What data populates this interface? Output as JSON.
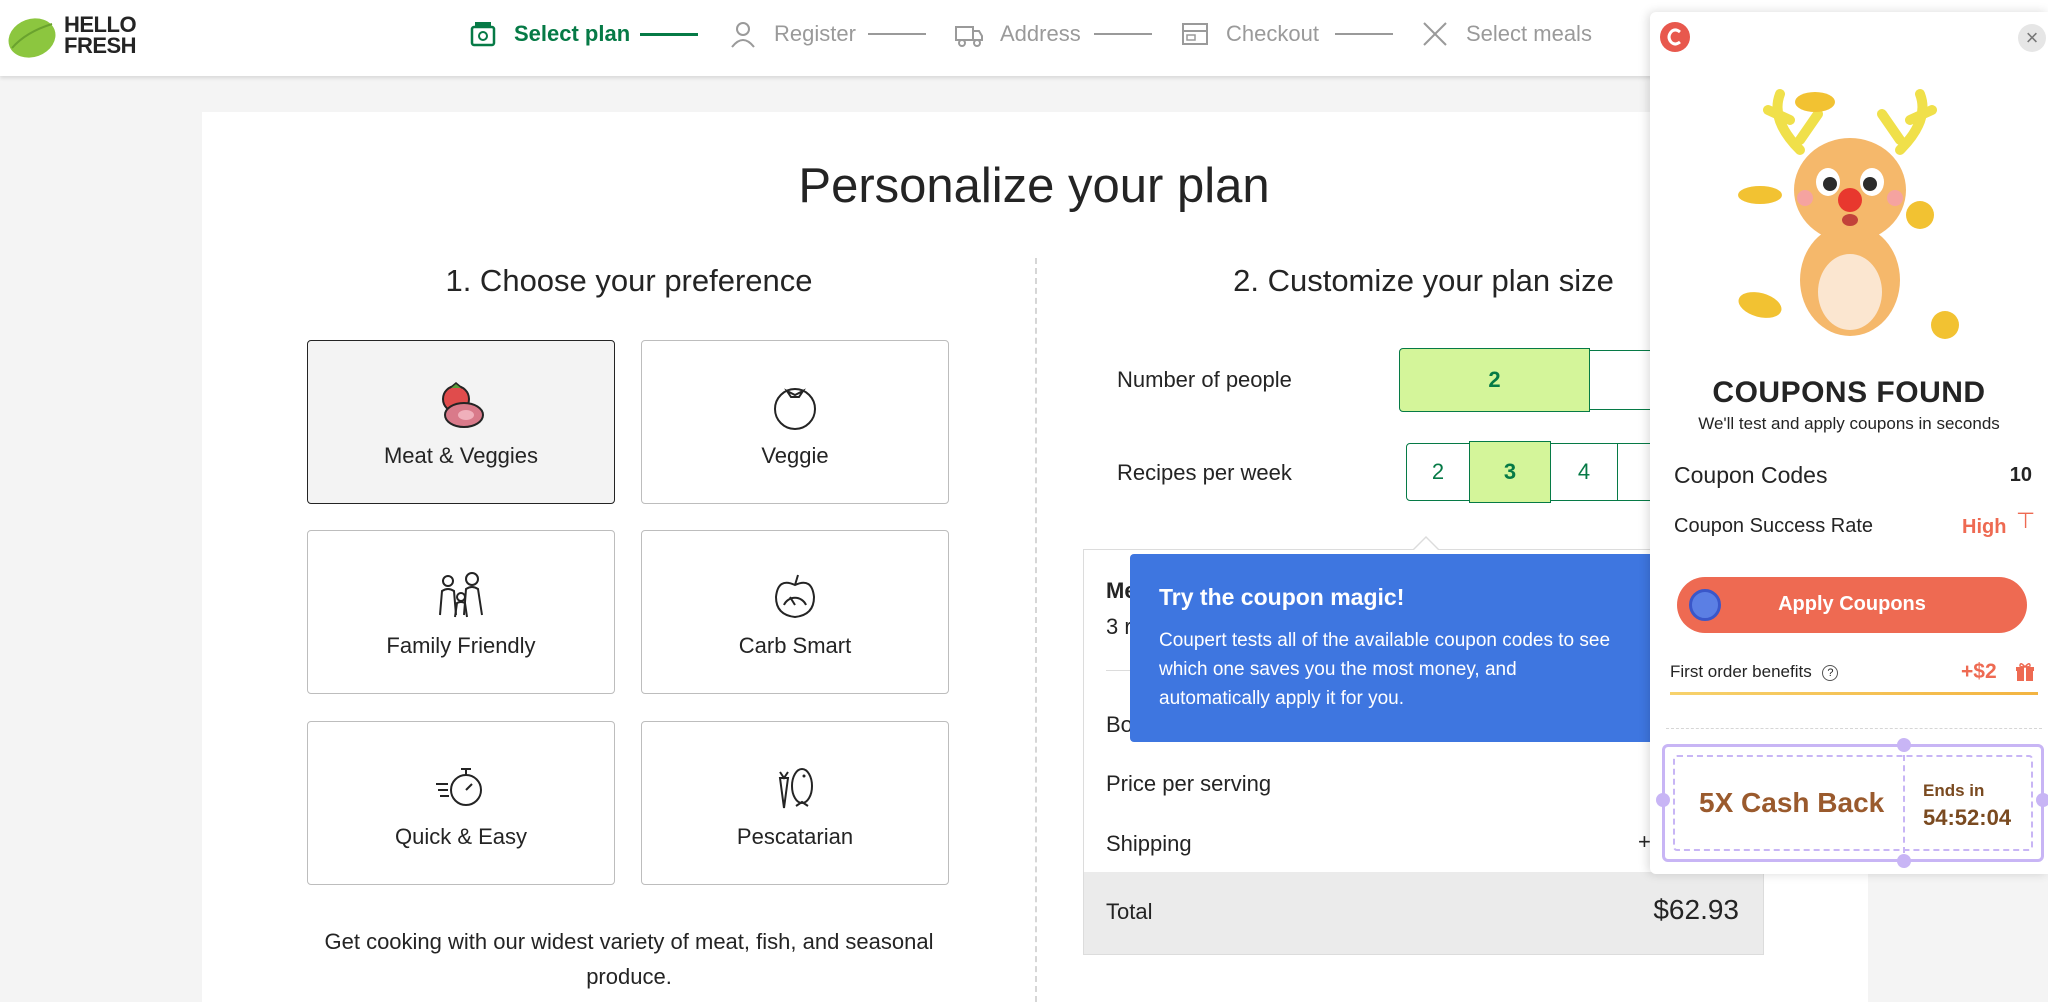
{
  "header": {
    "logo_line1": "HELLO",
    "logo_line2": "FRESH",
    "steps": [
      {
        "label": "Select plan",
        "icon": "plan-icon",
        "active": true
      },
      {
        "label": "Register",
        "icon": "user-icon",
        "active": false
      },
      {
        "label": "Address",
        "icon": "truck-icon",
        "active": false
      },
      {
        "label": "Checkout",
        "icon": "card-icon",
        "active": false
      },
      {
        "label": "Select meals",
        "icon": "fork-knife-icon",
        "active": false
      }
    ]
  },
  "page": {
    "title": "Personalize your plan",
    "section1_title": "1. Choose your preference",
    "section2_title": "2. Customize your plan size",
    "preferences": [
      {
        "label": "Meat & Veggies",
        "icon": "meat-veggies-icon",
        "selected": true
      },
      {
        "label": "Veggie",
        "icon": "tomato-icon",
        "selected": false
      },
      {
        "label": "Family Friendly",
        "icon": "family-icon",
        "selected": false
      },
      {
        "label": "Carb Smart",
        "icon": "apple-gauge-icon",
        "selected": false
      },
      {
        "label": "Quick & Easy",
        "icon": "stopwatch-icon",
        "selected": false
      },
      {
        "label": "Pescatarian",
        "icon": "fish-carrot-icon",
        "selected": false
      }
    ],
    "preference_description": "Get cooking with our widest variety of meat, fish, and seasonal produce.",
    "people_label": "Number of people",
    "people_options": [
      "2"
    ],
    "people_selected": "2",
    "recipes_label": "Recipes per week",
    "recipes_options": [
      "2",
      "3",
      "4"
    ],
    "recipes_selected": "3",
    "summary": {
      "meals_partial": "Me",
      "meals_count_partial": "3 r",
      "box_partial": "Bo",
      "price_per_serving": "Price per serving",
      "shipping": "Shipping",
      "shipping_partial": "+",
      "total_label": "Total",
      "total_value": "$62.93"
    }
  },
  "tooltip": {
    "title": "Try the coupon magic!",
    "body": "Coupert tests all of the available coupon codes to see which one saves you the most money, and automatically apply it for you."
  },
  "coupert": {
    "heading": "COUPONS FOUND",
    "subheading": "We'll test and apply coupons in seconds",
    "codes_label": "Coupon Codes",
    "codes_value": "10",
    "rate_label": "Coupon Success Rate",
    "rate_value": "High",
    "apply_label": "Apply Coupons",
    "first_order_label": "First order benefits",
    "first_order_value": "+$2",
    "cashback": "5X Cash Back",
    "ends_label": "Ends in",
    "ends_timer": "54:52:04",
    "accent": "#ee6a52"
  }
}
